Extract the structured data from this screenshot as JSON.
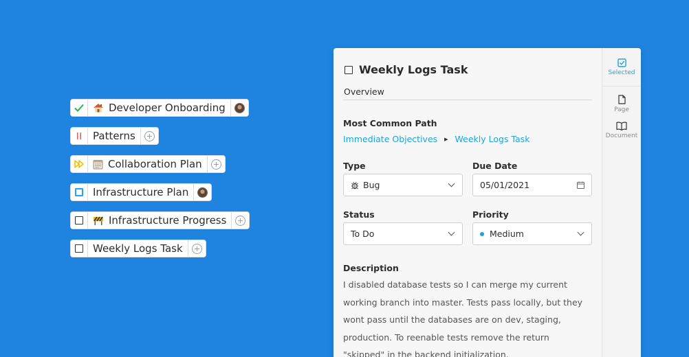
{
  "tasks": [
    {
      "status": "done",
      "status_icon": "check-icon",
      "emoji": "house-icon",
      "title": "Developer Onboarding",
      "tail": "avatar"
    },
    {
      "status": "paused",
      "status_icon": "pause-icon",
      "emoji": "",
      "title": "Patterns",
      "tail": "add"
    },
    {
      "status": "forward",
      "status_icon": "fast-forward-icon",
      "emoji": "calendar-icon",
      "title": "Collaboration Plan",
      "tail": "add"
    },
    {
      "status": "in-progress",
      "status_icon": "square-blue-icon",
      "emoji": "",
      "title": "Infrastructure Plan",
      "tail": "avatar"
    },
    {
      "status": "todo",
      "status_icon": "square-icon",
      "emoji": "construction-icon",
      "title": "Infrastructure Progress",
      "tail": "add"
    },
    {
      "status": "todo",
      "status_icon": "square-icon",
      "emoji": "",
      "title": "Weekly Logs Task",
      "tail": "add"
    }
  ],
  "panel": {
    "title": "Weekly Logs Task",
    "tab": "Overview",
    "path_label": "Most Common Path",
    "path": [
      "Immediate Objectives",
      "Weekly Logs Task"
    ],
    "type_label": "Type",
    "type_value": "Bug",
    "due_label": "Due Date",
    "due_value": "05/01/2021",
    "status_label": "Status",
    "status_value": "To Do",
    "priority_label": "Priority",
    "priority_value": "Medium",
    "description_label": "Description",
    "description": "I disabled database tests so I can merge my current working branch into master. Tests pass locally, but they wont pass until the databases are on dev, staging, production. To reenable tests remove the return \"skipped\" in the backend initialization."
  },
  "rail": {
    "selected": "Selected",
    "page": "Page",
    "document": "Document"
  },
  "colors": {
    "background": "#1f84e0",
    "accent": "#1ca5d9",
    "done": "#2bb24c",
    "paused": "#e25a5a",
    "forward": "#f2c200"
  }
}
